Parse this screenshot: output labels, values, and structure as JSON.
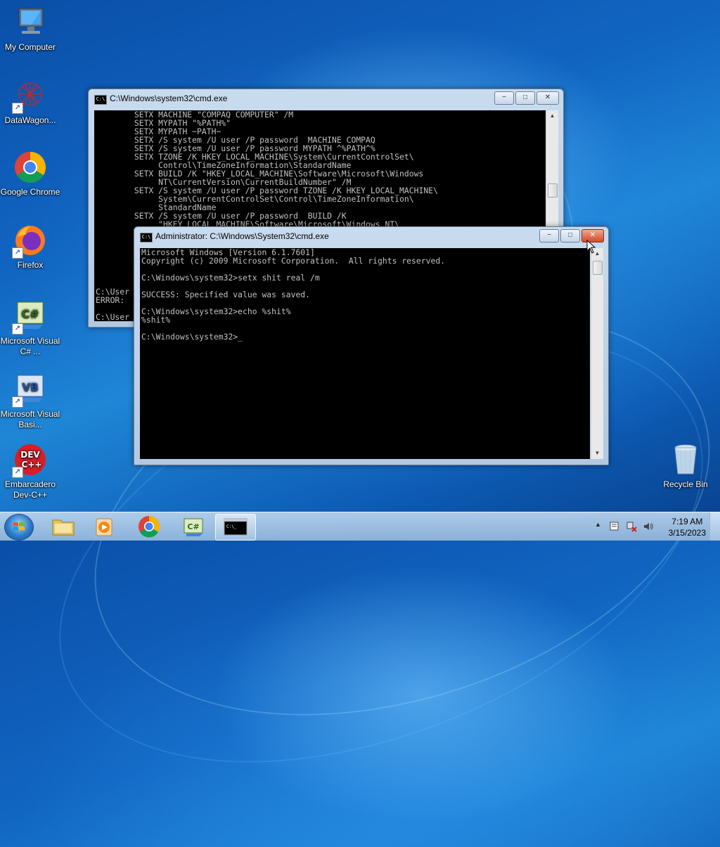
{
  "desktop": {
    "icons": [
      {
        "label": "My Computer"
      },
      {
        "label": "DataWagon..."
      },
      {
        "label": "Google Chrome"
      },
      {
        "label": "Firefox"
      },
      {
        "label": "Microsoft Visual C# ..."
      },
      {
        "label": "Microsoft Visual Basi..."
      },
      {
        "label": "Embarcadero Dev-C++"
      },
      {
        "label": "Recycle Bin"
      }
    ]
  },
  "back_window": {
    "title": "C:\\Windows\\system32\\cmd.exe",
    "console_text": "        SETX MACHINE \"COMPAQ COMPUTER\" /M\n        SETX MYPATH \"%PATH%\"\n        SETX MYPATH ~PATH~\n        SETX /S system /U user /P password  MACHINE COMPAQ\n        SETX /S system /U user /P password MYPATH ^%PATH^%\n        SETX TZONE /K HKEY_LOCAL_MACHINE\\System\\CurrentControlSet\\\n             Control\\TimeZoneInformation\\StandardName\n        SETX BUILD /K \"HKEY_LOCAL_MACHINE\\Software\\Microsoft\\Windows\n             NT\\CurrentVersion\\CurrentBuildNumber\" /M\n        SETX /S system /U user /P password TZONE /K HKEY_LOCAL_MACHINE\\\n             System\\CurrentControlSet\\Control\\TimeZoneInformation\\\n             StandardName\n        SETX /S system /U user /P password  BUILD /K\n             \"HKEY_LOCAL_MACHINE\\Software\\Microsoft\\Windows NT\\\n\n        SET\n        SET\n        SET\n        SET\n        SET\n\nC:\\User\nERROR:\n\nC:\\User"
  },
  "front_window": {
    "title": "Administrator: C:\\Windows\\System32\\cmd.exe",
    "console_text": "Microsoft Windows [Version 6.1.7601]\nCopyright (c) 2009 Microsoft Corporation.  All rights reserved.\n\nC:\\Windows\\system32>setx shit real /m\n\nSUCCESS: Specified value was saved.\n\nC:\\Windows\\system32>echo %shit%\n%shit%\n\nC:\\Windows\\system32>_"
  },
  "window_controls": {
    "minimize": "−",
    "maximize": "□",
    "close": "✕"
  },
  "taskbar": {
    "clock_time": "7:19 AM",
    "clock_date": "3/15/2023",
    "tray_arrow": "▲"
  },
  "colors": {
    "console_bg": "#000000",
    "console_fg": "#c0c0c0",
    "close_red": "#cf4a2b"
  }
}
